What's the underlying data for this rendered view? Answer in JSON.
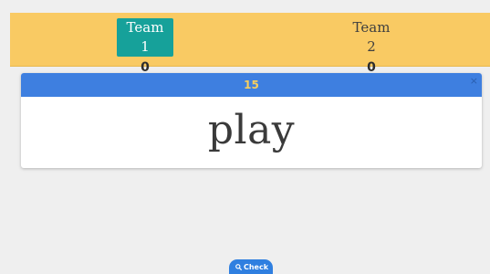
{
  "scoreboard": {
    "teams": [
      {
        "name": "Team 1",
        "score": "0",
        "active": true
      },
      {
        "name": "Team 2",
        "score": "0",
        "active": false
      }
    ]
  },
  "card": {
    "timer": "15",
    "close_symbol": "×",
    "word": "play"
  },
  "actions": {
    "check_label": "Check",
    "check_icon": "search-icon"
  },
  "colors": {
    "scoreboard_bg": "#f9ca63",
    "active_team_bg": "#16a19a",
    "card_header_bg": "#3e7fe0",
    "timer_text": "#f7cf5e",
    "check_button_bg": "#2f7fe0"
  }
}
